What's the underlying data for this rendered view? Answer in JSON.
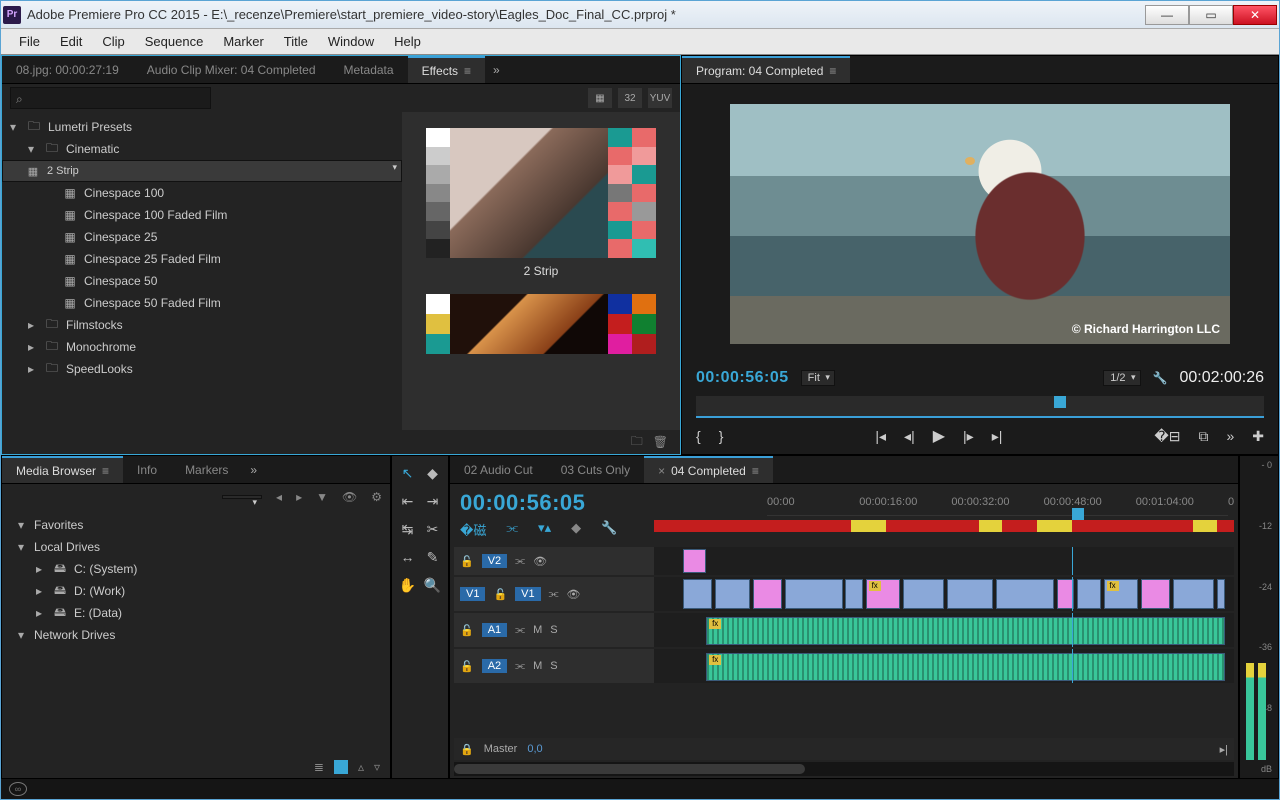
{
  "window": {
    "title": "Adobe Premiere Pro CC 2015 - E:\\_recenze\\Premiere\\start_premiere_video-story\\Eagles_Doc_Final_CC.prproj *",
    "logo": "Pr"
  },
  "menubar": [
    "File",
    "Edit",
    "Clip",
    "Sequence",
    "Marker",
    "Title",
    "Window",
    "Help"
  ],
  "effects_panel": {
    "tabs": [
      {
        "label": "08.jpg: 00:00:27:19",
        "active": false
      },
      {
        "label": "Audio Clip Mixer: 04 Completed",
        "active": false
      },
      {
        "label": "Metadata",
        "active": false
      },
      {
        "label": "Effects",
        "active": true
      }
    ],
    "search_placeholder": "",
    "icon_buttons": [
      "fx-badge",
      "32",
      "YUV"
    ],
    "tree": [
      {
        "label": "Lumetri Presets",
        "type": "folder",
        "open": true,
        "indent": 0
      },
      {
        "label": "Cinematic",
        "type": "folder",
        "open": true,
        "indent": 1
      },
      {
        "label": "2 Strip",
        "type": "preset",
        "indent": 2,
        "selected": true
      },
      {
        "label": "Cinespace 100",
        "type": "preset",
        "indent": 2
      },
      {
        "label": "Cinespace 100 Faded Film",
        "type": "preset",
        "indent": 2
      },
      {
        "label": "Cinespace 25",
        "type": "preset",
        "indent": 2
      },
      {
        "label": "Cinespace 25 Faded Film",
        "type": "preset",
        "indent": 2
      },
      {
        "label": "Cinespace 50",
        "type": "preset",
        "indent": 2
      },
      {
        "label": "Cinespace 50 Faded Film",
        "type": "preset",
        "indent": 2
      },
      {
        "label": "Filmstocks",
        "type": "folder",
        "open": false,
        "indent": 1
      },
      {
        "label": "Monochrome",
        "type": "folder",
        "open": false,
        "indent": 1
      },
      {
        "label": "SpeedLooks",
        "type": "folder",
        "open": false,
        "indent": 1
      }
    ],
    "presets_preview": [
      {
        "label": "2 Strip"
      },
      {
        "label": ""
      }
    ]
  },
  "program_monitor": {
    "tab": "Program: 04 Completed",
    "credit": "© Richard Harrington LLC",
    "current_tc": "00:00:56:05",
    "duration_tc": "00:02:00:26",
    "zoom_sel": "Fit",
    "res_sel": "1/2"
  },
  "media_browser": {
    "tabs": [
      {
        "label": "Media Browser",
        "active": true
      },
      {
        "label": "Info",
        "active": false
      },
      {
        "label": "Markers",
        "active": false
      }
    ],
    "tree": [
      {
        "label": "Favorites",
        "type": "section",
        "indent": 0
      },
      {
        "label": "Local Drives",
        "type": "section",
        "indent": 0,
        "open": true
      },
      {
        "label": "C: (System)",
        "type": "drive",
        "indent": 1
      },
      {
        "label": "D: (Work)",
        "type": "drive",
        "indent": 1
      },
      {
        "label": "E: (Data)",
        "type": "drive",
        "indent": 1
      },
      {
        "label": "Network Drives",
        "type": "section",
        "indent": 0
      }
    ]
  },
  "timeline": {
    "seq_tabs": [
      {
        "label": "02 Audio Cut",
        "active": false
      },
      {
        "label": "03 Cuts Only",
        "active": false
      },
      {
        "label": "04 Completed",
        "active": true
      }
    ],
    "current_tc": "00:00:56:05",
    "ruler": [
      "00:00",
      "00:00:16:00",
      "00:00:32:00",
      "00:00:48:00",
      "00:01:04:00",
      "0"
    ],
    "playhead_pct": 72,
    "work_area_yellow": [
      [
        34,
        6
      ],
      [
        56,
        4
      ],
      [
        66,
        6
      ],
      [
        93,
        4
      ]
    ],
    "tracks": {
      "v2": {
        "label": "V2"
      },
      "v1": {
        "src": "V1",
        "label": "V1"
      },
      "a1": {
        "label": "A1",
        "mute": "M",
        "solo": "S"
      },
      "a2": {
        "label": "A2",
        "mute": "M",
        "solo": "S"
      },
      "master": {
        "label": "Master",
        "val": "0,0"
      }
    },
    "v2_clips": [
      [
        5,
        4
      ]
    ],
    "v1_clips": [
      [
        5,
        5
      ],
      [
        10.5,
        6
      ],
      [
        17,
        5
      ],
      [
        22.5,
        10
      ],
      [
        33,
        3
      ],
      [
        36.5,
        6
      ],
      [
        43,
        7
      ],
      [
        50.5,
        8
      ],
      [
        59,
        10
      ],
      [
        69.5,
        3
      ],
      [
        73,
        4
      ],
      [
        77.5,
        6
      ],
      [
        84,
        5
      ],
      [
        89.5,
        7
      ],
      [
        97,
        1.5
      ]
    ],
    "v1_pink": [
      2,
      5,
      9,
      12
    ],
    "a_clips": [
      [
        9,
        89.5
      ]
    ]
  },
  "meters": {
    "scale": [
      "- 0",
      "-12",
      "-24",
      "-36",
      "-48",
      "dB"
    ]
  },
  "colors": {
    "accent": "#39a7d6",
    "pink": "#ea8ae4",
    "blueclip": "#8aa8d8",
    "audio": "#39c69a"
  }
}
